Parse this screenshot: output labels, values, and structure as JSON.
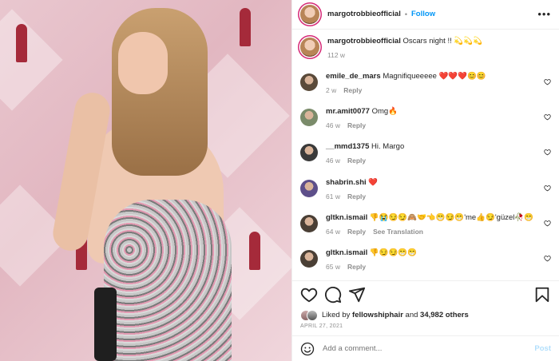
{
  "post": {
    "username": "margotrobbieofficial",
    "follow_label": "Follow",
    "dot": "•",
    "more": "•••"
  },
  "caption": {
    "username": "margotrobbieofficial",
    "text": "Oscars night !! 💫💫💫",
    "time": "112 w"
  },
  "comments": [
    {
      "username": "emile_de_mars",
      "text": "Magnifiqueeeee ❤️❤️❤️😊😊",
      "time": "2 w",
      "reply": "Reply",
      "avatar_color": "#5a4a3a"
    },
    {
      "username": "mr.amit0077",
      "text": "Omg🔥",
      "time": "46 w",
      "reply": "Reply",
      "avatar_color": "#7a8b6a"
    },
    {
      "username": "__mmd1375",
      "text": "Hi. Margo",
      "time": "46 w",
      "reply": "Reply",
      "avatar_color": "#3a3a3a"
    },
    {
      "username": "shabrin.shi",
      "text": "❤️",
      "time": "61 w",
      "reply": "Reply",
      "avatar_color": "#5d4f8a"
    },
    {
      "username": "gltkn.ismail",
      "text": "👎😭😏😏🙈🤝👈😁😏😁'me👍😏'güzel🥀😁",
      "time": "64 w",
      "reply": "Reply",
      "translation": "See Translation",
      "avatar_color": "#4a3f35"
    },
    {
      "username": "gltkn.ismail",
      "text": "👎😏😏😁😁",
      "time": "65 w",
      "reply": "Reply",
      "avatar_color": "#4a3f35"
    }
  ],
  "likes": {
    "prefix": "Liked by",
    "user": "fellowshiphair",
    "and": "and",
    "others": "34,982 others"
  },
  "date": "APRIL 27, 2021",
  "add_comment": {
    "placeholder": "Add a comment...",
    "post_label": "Post"
  }
}
